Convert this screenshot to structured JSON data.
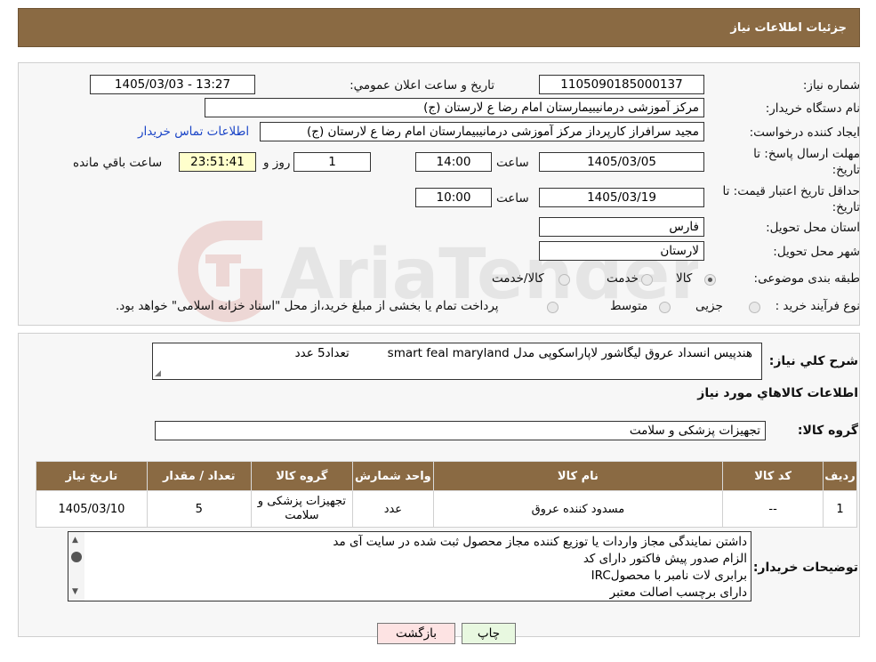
{
  "header": {
    "title": "جزئیات اطلاعات نیاز"
  },
  "info": {
    "need_number_label": "شماره نیاز:",
    "need_number": "1105090185000137",
    "announce_label": "تاريخ و ساعت اعلان عمومي:",
    "announce_value": "1405/03/03 - 13:27",
    "buyer_label": "نام دستگاه خريدار:",
    "buyer_value": "مرکز آموزشی درمانیبیمارستان امام رضا  ع  لارستان (ج)",
    "creator_label": "ایجاد کننده درخواست:",
    "creator_value": "مجید سرافراز کارپرداز  مرکز آموزشی درمانیبیمارستان امام رضا  ع  لارستان (ج)",
    "contact_link": "اطلاعات تماس خریدار",
    "deadline_label_1": "مهلت ارسال پاسخ: تا",
    "deadline_label_2": "تاریخ:",
    "deadline_date": "1405/03/05",
    "time_label": "ساعت",
    "deadline_time": "14:00",
    "days_value": "1",
    "days_label": "روز و",
    "remaining_value": "23:51:41",
    "remaining_label": "ساعت باقي مانده",
    "validity_label_1": "حداقل تاریخ اعتبار قیمت: تا",
    "validity_label_2": "تاریخ:",
    "validity_date": "1405/03/19",
    "validity_time": "10:00",
    "province_label": "استان محل تحویل:",
    "province_value": "فارس",
    "city_label": "شهر محل تحویل:",
    "city_value": "لارستان",
    "category_label": "طبقه بندی موضوعی:",
    "category_options": [
      "کالا",
      "خدمت",
      "کالا/خدمت"
    ],
    "process_label": "نوع فرآیند خرید :",
    "process_options": [
      "جزیی",
      "متوسط"
    ],
    "process_note": "پرداخت تمام یا بخشی از مبلغ خرید،از محل \"اسناد خزانه اسلامی\" خواهد بود."
  },
  "description": {
    "label": "شرح کلي نياز:",
    "value": "هندپیس انسداد عروق لیگاشور لاپاراسکوپی مدل smart feal maryland          تعداد5 عدد"
  },
  "goods": {
    "section_title": "اطلاعات کالاهاي مورد نياز",
    "group_label": "گروه کالا:",
    "group_value": "تجهیزات پزشکی و سلامت",
    "columns": [
      "رديف",
      "کد کالا",
      "نام کالا",
      "واحد شمارش",
      "گروه کالا",
      "تعداد / مقدار",
      "تاريخ نياز"
    ],
    "rows": [
      {
        "row": "1",
        "code": "--",
        "name": "مسدود کننده عروق",
        "unit": "عدد",
        "group": "تجهیزات پزشکی و سلامت",
        "qty": "5",
        "date": "1405/03/10"
      }
    ]
  },
  "buyer_notes": {
    "label": "توضیحات خریدار:",
    "lines": [
      "داشتن نمایندگی مجاز واردات یا توزیع کننده مجاز محصول ثبت شده در سایت آی مد",
      "الزام صدور پیش فاکتور دارای کد",
      "برابری لات نامبر با محصولIRC",
      "دارای برچسب اصالت معتبر"
    ]
  },
  "buttons": {
    "print": "چاپ",
    "back": "بازگشت"
  },
  "watermark": {
    "text": "AriaTender.neT"
  },
  "colors": {
    "header_bg": "#8a6a43",
    "link": "#1b45c7",
    "yellow_box": "#ffffcc",
    "back_button_bg": "#fde3e3",
    "print_button_bg": "#e8f8e0"
  }
}
